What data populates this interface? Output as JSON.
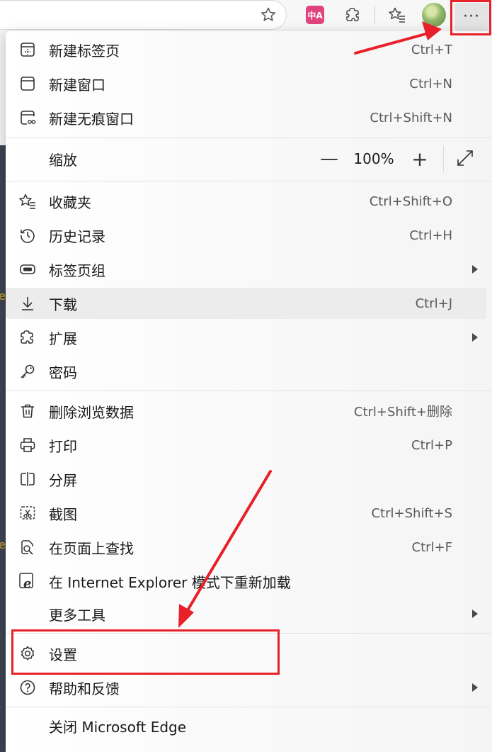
{
  "toolbar": {
    "icons": [
      "star-icon",
      "translate-icon",
      "extensions-icon",
      "favorites-icon",
      "profile-avatar",
      "more-icon"
    ],
    "more_label": "···"
  },
  "menu": {
    "items": [
      {
        "label": "新建标签页",
        "shortcut": "Ctrl+T",
        "icon": "new-tab-icon"
      },
      {
        "label": "新建窗口",
        "shortcut": "Ctrl+N",
        "icon": "new-window-icon"
      },
      {
        "label": "新建无痕窗口",
        "shortcut": "Ctrl+Shift+N",
        "icon": "inprivate-window-icon"
      },
      {
        "label": "缩放",
        "icon": ""
      },
      {
        "label": "收藏夹",
        "shortcut": "Ctrl+Shift+O",
        "icon": "favorites-icon"
      },
      {
        "label": "历史记录",
        "shortcut": "Ctrl+H",
        "icon": "history-icon"
      },
      {
        "label": "标签页组",
        "shortcut": "",
        "icon": "tab-groups-icon",
        "submenu": true
      },
      {
        "label": "下载",
        "shortcut": "Ctrl+J",
        "icon": "download-icon"
      },
      {
        "label": "扩展",
        "shortcut": "",
        "icon": "extensions-icon",
        "submenu": true
      },
      {
        "label": "密码",
        "shortcut": "",
        "icon": "key-icon"
      },
      {
        "label": "删除浏览数据",
        "shortcut": "Ctrl+Shift+删除",
        "icon": "trash-icon"
      },
      {
        "label": "打印",
        "shortcut": "Ctrl+P",
        "icon": "print-icon"
      },
      {
        "label": "分屏",
        "shortcut": "",
        "icon": "split-screen-icon"
      },
      {
        "label": "截图",
        "shortcut": "Ctrl+Shift+S",
        "icon": "screenshot-icon"
      },
      {
        "label": "在页面上查找",
        "shortcut": "Ctrl+F",
        "icon": "find-icon"
      },
      {
        "label": "在 Internet Explorer 模式下重新加载",
        "shortcut": "",
        "icon": "ie-icon"
      },
      {
        "label": "更多工具",
        "shortcut": "",
        "icon": "",
        "submenu": true
      },
      {
        "label": "设置",
        "shortcut": "",
        "icon": "gear-icon"
      },
      {
        "label": "帮助和反馈",
        "shortcut": "",
        "icon": "help-icon",
        "submenu": true
      },
      {
        "label": "关闭 Microsoft Edge",
        "shortcut": "",
        "icon": ""
      }
    ],
    "zoom": {
      "minus": "—",
      "value": "100%",
      "plus": "+"
    }
  },
  "annotations": {
    "color": "#e8202a"
  }
}
